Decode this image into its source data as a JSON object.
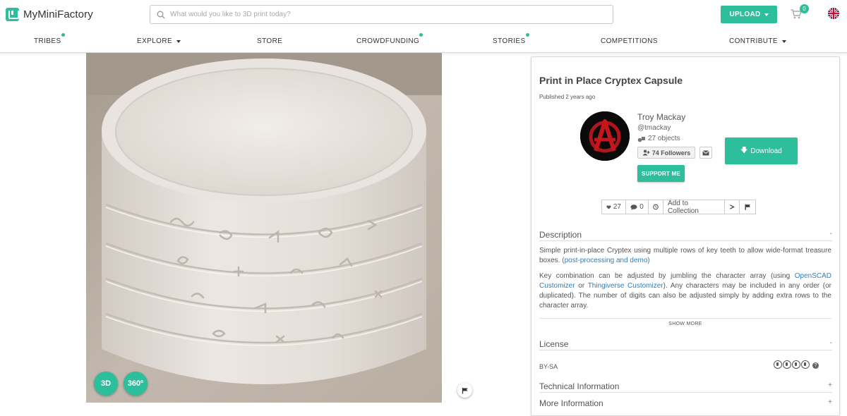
{
  "header": {
    "brand": "MyMiniFactory",
    "search_placeholder": "What would you like to 3D print today?",
    "upload_label": "UPLOAD",
    "cart_count": "0",
    "accent_color": "#2dbe9c"
  },
  "nav": {
    "tribes": "TRIBES",
    "explore": "EXPLORE",
    "store": "STORE",
    "crowdfunding": "CROWDFUNDING",
    "stories": "STORIES",
    "competitions": "COMPETITIONS",
    "contribute": "CONTRIBUTE"
  },
  "viewer": {
    "btn_3d": "3D",
    "btn_360": "360º"
  },
  "object": {
    "title": "Print in Place Cryptex Capsule",
    "published": "Published 2 years ago"
  },
  "author": {
    "name": "Troy Mackay",
    "handle": "@tmackay",
    "objects": "27 objects",
    "followers": "74 Followers",
    "support_label": "SUPPORT ME"
  },
  "download_label": "Download",
  "actions": {
    "likes": "27",
    "comments": "0",
    "add_to_collection": "Add to Collection"
  },
  "description": {
    "heading": "Description",
    "toggle": "-",
    "p1_text": "Simple print-in-place Cryptex using multiple rows of key teeth to allow wide-format treasure boxes.",
    "p1_link": "(post-processing and demo)",
    "p2_a": "Key combination can be adjusted by jumbling the character array (using",
    "p2_link1": "OpenSCAD Customizer",
    "p2_b": "or",
    "p2_link2": "Thingiverse Customizer",
    "p2_c": "). Any characters may be included in any order (or duplicated). The number of digits can also be adjusted simply by adding extra rows to the character array.",
    "show_more": "SHOW MORE"
  },
  "license": {
    "heading": "License",
    "toggle": "-",
    "value": "BY-SA",
    "help": "?"
  },
  "technical": {
    "heading": "Technical Information",
    "toggle": "+"
  },
  "more": {
    "heading": "More Information",
    "toggle": "+"
  }
}
